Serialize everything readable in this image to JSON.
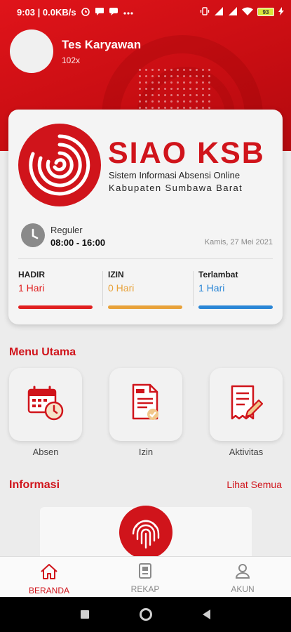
{
  "status_bar": {
    "time_speed": "9:03 | 0.0KB/s",
    "battery": "93",
    "icons": [
      "alarm-icon",
      "message-icon",
      "chat-icon",
      "more-icon",
      "vibrate-icon",
      "signal-icon",
      "signal-icon",
      "wifi-icon",
      "battery-icon",
      "charging-icon"
    ]
  },
  "user": {
    "name": "Tes Karyawan",
    "id": "102x"
  },
  "brand": {
    "title": "SIAO KSB",
    "subtitle_line1": "Sistem Informasi Absensi Online",
    "subtitle_line2": "Kabupaten Sumbawa Barat",
    "color": "#d0141b"
  },
  "schedule": {
    "type": "Reguler",
    "time": "08:00 - 16:00",
    "date": "Kamis, 27 Mei 2021"
  },
  "stats": [
    {
      "label": "HADIR",
      "value": "1 Hari",
      "color": "#e02020"
    },
    {
      "label": "IZIN",
      "value": "0 Hari",
      "color": "#e8a23a"
    },
    {
      "label": "Terlambat",
      "value": "1 Hari",
      "color": "#2a86d6"
    }
  ],
  "menu": {
    "title": "Menu Utama",
    "items": [
      {
        "label": "Absen",
        "icon": "calendar-clock-icon"
      },
      {
        "label": "Izin",
        "icon": "document-check-icon"
      },
      {
        "label": "Aktivitas",
        "icon": "receipt-pen-icon"
      }
    ]
  },
  "info": {
    "title": "Informasi",
    "see_all": "Lihat Semua",
    "icon": "fingerprint-icon"
  },
  "bottom_nav": [
    {
      "label": "BERANDA",
      "icon": "home-icon",
      "active": true
    },
    {
      "label": "REKAP",
      "icon": "file-icon",
      "active": false
    },
    {
      "label": "AKUN",
      "icon": "user-icon",
      "active": false
    }
  ],
  "system_nav": [
    "recents-icon",
    "home-circle-icon",
    "back-icon"
  ]
}
